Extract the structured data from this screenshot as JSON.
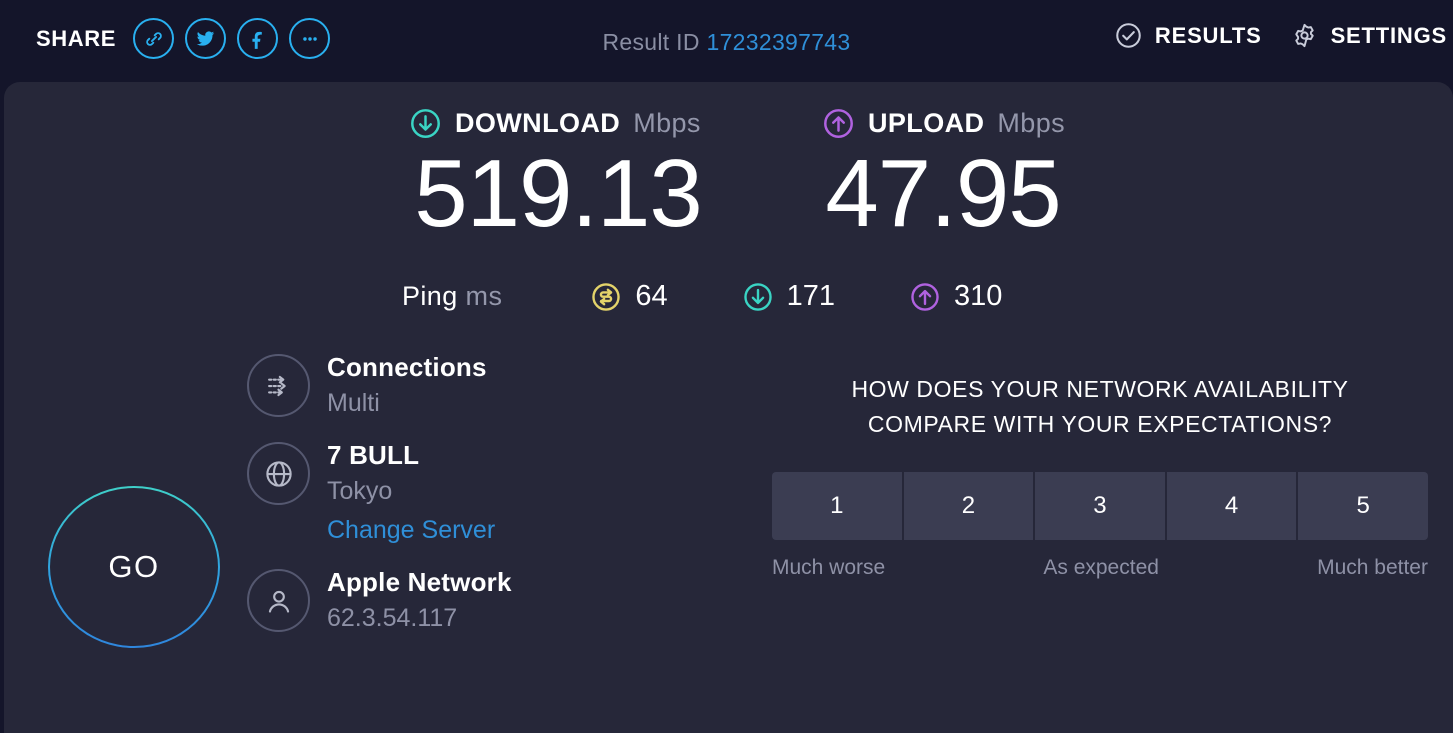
{
  "topbar": {
    "share_label": "SHARE",
    "share_buttons": [
      {
        "name": "link-icon",
        "label": "Copy link"
      },
      {
        "name": "twitter-icon",
        "label": "Share on Twitter"
      },
      {
        "name": "facebook-icon",
        "label": "Share on Facebook"
      },
      {
        "name": "more-icon",
        "label": "More sharing options"
      }
    ],
    "result_id_label": "Result ID",
    "result_id_value": "17232397743",
    "results_label": "RESULTS",
    "settings_label": "SETTINGS"
  },
  "download": {
    "name": "DOWNLOAD",
    "unit": "Mbps",
    "value": "519.13",
    "color": "#3ad4c4"
  },
  "upload": {
    "name": "UPLOAD",
    "unit": "Mbps",
    "value": "47.95",
    "color": "#b062e0"
  },
  "ping": {
    "name": "Ping",
    "unit": "ms",
    "idle": "64",
    "download": "171",
    "upload": "310",
    "idle_color": "#e3d36a"
  },
  "go_button": {
    "label": "GO"
  },
  "info": {
    "connections": {
      "title": "Connections",
      "sub": "Multi"
    },
    "server": {
      "title": "7 BULL",
      "sub": "Tokyo",
      "link": "Change Server"
    },
    "client": {
      "title": "Apple Network",
      "sub": "62.3.54.117"
    }
  },
  "survey": {
    "question_line1": "HOW DOES YOUR NETWORK AVAILABILITY",
    "question_line2": "COMPARE WITH YOUR EXPECTATIONS?",
    "options": [
      "1",
      "2",
      "3",
      "4",
      "5"
    ],
    "scale_low": "Much worse",
    "scale_mid": "As expected",
    "scale_high": "Much better"
  }
}
